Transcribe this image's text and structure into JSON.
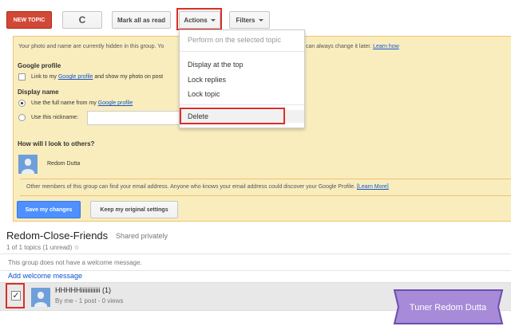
{
  "toolbar": {
    "new_topic": "NEW TOPIC",
    "refresh_glyph": "C",
    "mark_all_read": "Mark all as read",
    "actions": "Actions",
    "filters": "Filters"
  },
  "actions_menu": {
    "items": [
      {
        "label": "Perform on the selected topic",
        "disabled": true
      },
      {
        "label": "Display at the top",
        "disabled": false
      },
      {
        "label": "Lock replies",
        "disabled": false
      },
      {
        "label": "Lock topic",
        "disabled": false
      },
      {
        "label": "Delete",
        "disabled": false
      }
    ]
  },
  "privacy": {
    "intro_left": "Your photo and name are currently hidden in this group. Yo",
    "intro_right": "can always change it later.",
    "learn_how": "Learn how",
    "google_profile_heading": "Google profile",
    "link_profile_prefix": "Link to my ",
    "link_profile_link": "Google profile",
    "link_profile_suffix": " and show my photo on post",
    "display_name_heading": "Display name",
    "use_full_name_prefix": "Use the full name from my ",
    "use_full_name_link": "Google profile",
    "use_nickname": "Use this nickname:",
    "nickname_value": "",
    "look_heading": "How will I look to others?",
    "preview_name": "Redom Dutta",
    "notice_text": "Other members of this group can find your email address. Anyone who knows your email address could discover your Google Profile. ",
    "learn_more": "[Learn More]",
    "save_button": "Save my changes",
    "keep_button": "Keep my original settings"
  },
  "group": {
    "name": "Redom-Close-Friends",
    "shared": "Shared privately",
    "topics_count": "1 of 1 topics (1 unread)",
    "star_glyph": "☆",
    "welcome_msg": "This group does not have a welcome message.",
    "add_welcome": "Add welcome message"
  },
  "topic_row": {
    "checked_glyph": "✓",
    "title": "HHHHHiiiiiiiiiiii  (1)",
    "meta": "By me - 1 post - 0 views"
  },
  "watermark": {
    "text": "Tuner Redom Dutta",
    "color": "#a78bd8"
  },
  "colors": {
    "new_topic_bg": "#d14836",
    "save_bg": "#4d90fe",
    "highlight_red": "#d93025",
    "yellow_bg": "#f9edbe",
    "link": "#1155cc"
  }
}
